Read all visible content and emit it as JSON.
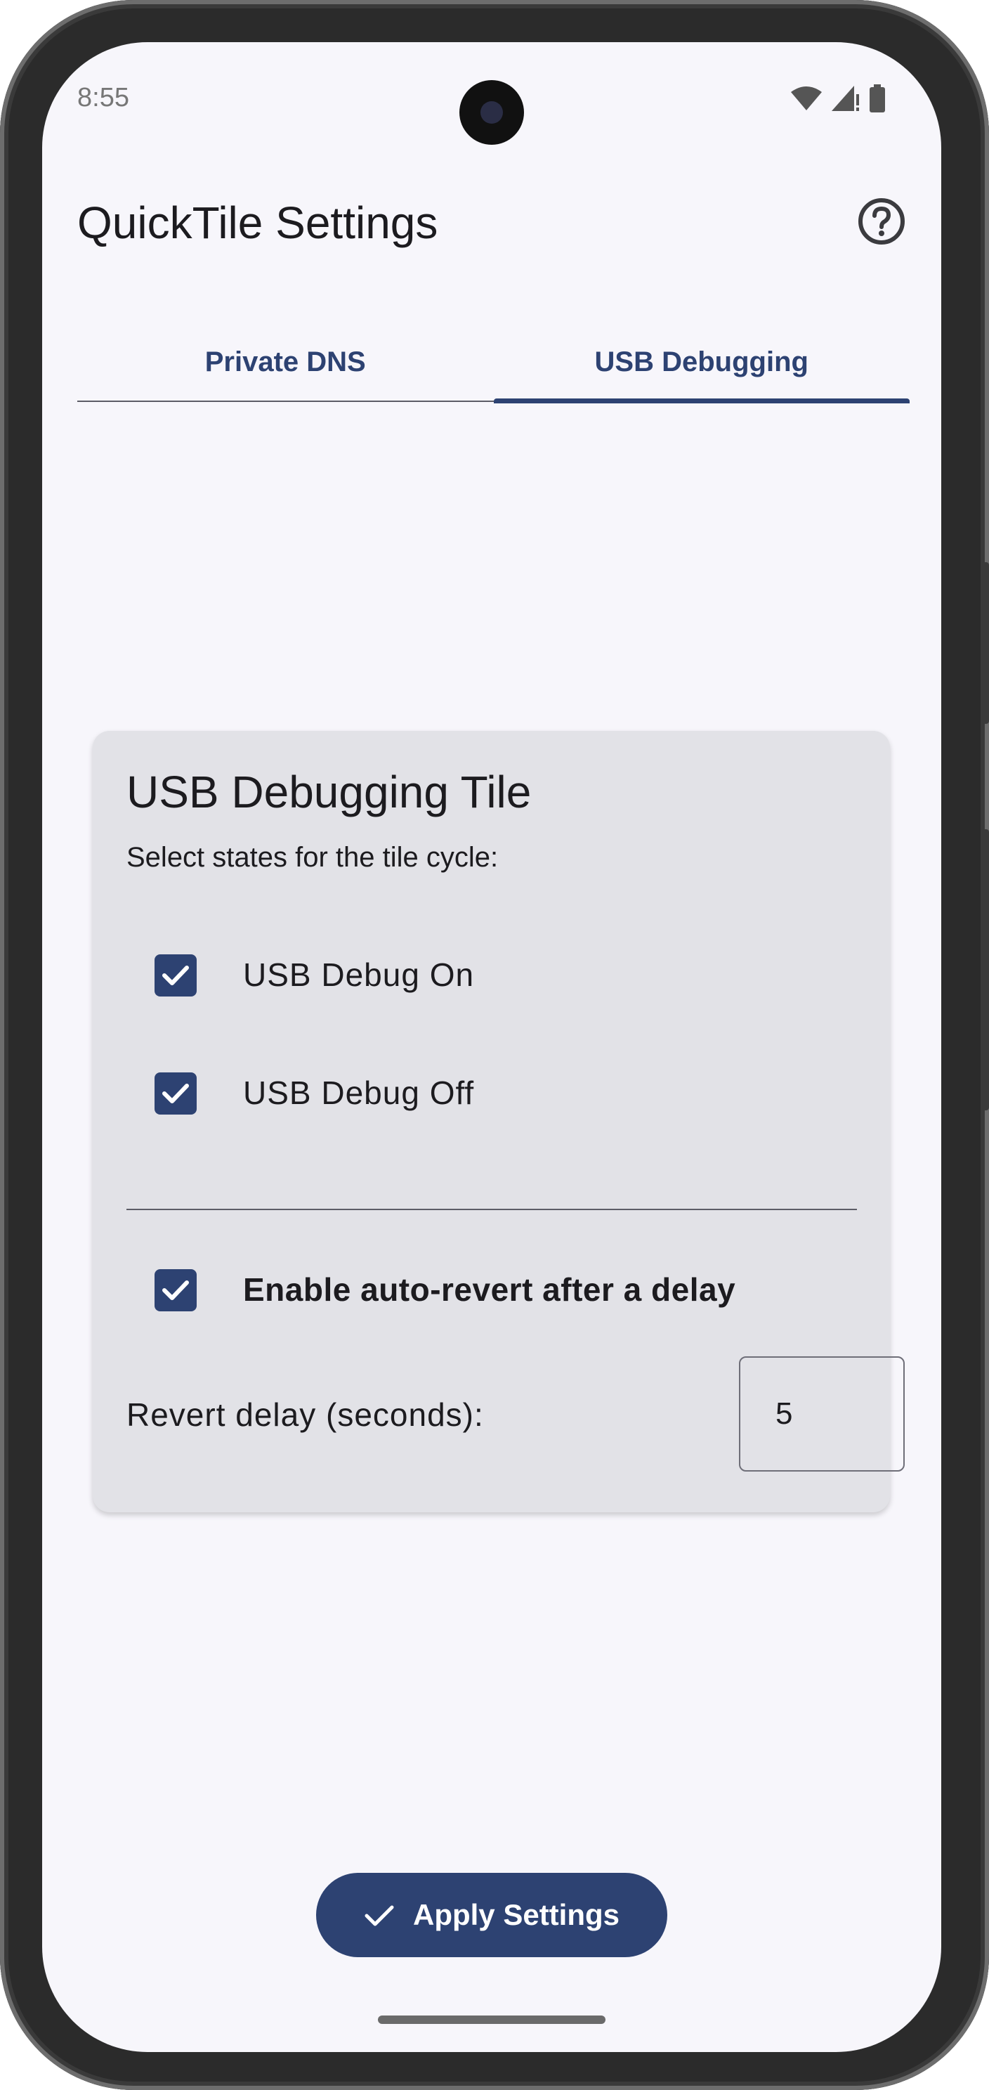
{
  "status_bar": {
    "time": "8:55",
    "icons": [
      "wifi-icon",
      "cell-signal-icon",
      "battery-icon"
    ]
  },
  "app_bar": {
    "title": "QuickTile Settings",
    "help_icon": "help-circle-icon"
  },
  "tabs": [
    {
      "label": "Private DNS",
      "active": false
    },
    {
      "label": "USB Debugging",
      "active": true
    }
  ],
  "card": {
    "title": "USB Debugging Tile",
    "subtitle": "Select states for the tile cycle:",
    "states": [
      {
        "label": "USB Debug On",
        "checked": true
      },
      {
        "label": "USB Debug Off",
        "checked": true
      }
    ],
    "auto_revert": {
      "label": "Enable auto-revert after a delay",
      "checked": true
    },
    "delay": {
      "label": "Revert delay (seconds):",
      "value": "5"
    }
  },
  "apply_button": {
    "label": "Apply Settings",
    "icon": "check-icon"
  },
  "colors": {
    "accent": "#2d4272",
    "surface": "#e2e2e7",
    "background": "#f7f6fb"
  }
}
